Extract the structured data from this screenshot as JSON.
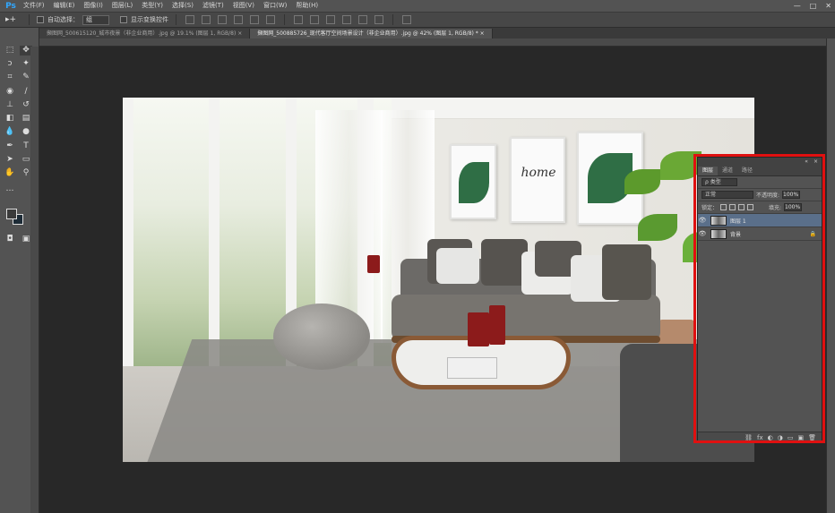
{
  "app": {
    "logo": "Ps"
  },
  "menu": [
    "文件(F)",
    "编辑(E)",
    "图像(I)",
    "图层(L)",
    "类型(Y)",
    "选择(S)",
    "滤镜(T)",
    "视图(V)",
    "窗口(W)",
    "帮助(H)"
  ],
  "window_controls": [
    "—",
    "□",
    "✕"
  ],
  "options_bar": {
    "auto_select_label": "自动选择：",
    "auto_select_value": "组",
    "show_transform_label": "显示变换控件"
  },
  "tabs": [
    {
      "label": "撷图网_500615120_城市夜景（非企业商用）.jpg @ 19.1% (图层 1, RGB/8) ×",
      "active": false
    },
    {
      "label": "撷图网_500885726_现代客厅空间场景设计（非企业商用）.jpg @ 42% (图层 1, RGB/8) * ×",
      "active": true
    }
  ],
  "artwork": {
    "home_text": "home"
  },
  "layers_panel": {
    "header_icons": [
      "«",
      "×"
    ],
    "tabs": [
      "图层",
      "通道",
      "路径"
    ],
    "filter_label": "ρ 类型",
    "blend_mode": "正常",
    "opacity_label": "不透明度:",
    "opacity_value": "100%",
    "lock_label": "锁定：",
    "fill_label": "填充:",
    "fill_value": "100%",
    "layers": [
      {
        "name": "图层 1",
        "selected": true,
        "visible_icon": "👁"
      },
      {
        "name": "背景",
        "selected": false,
        "visible_icon": "👁",
        "locked": true
      }
    ],
    "footer_icons": [
      "⛓",
      "fx",
      "◐",
      "◑",
      "▭",
      "▣",
      "🗑"
    ]
  },
  "colors": {
    "highlight": "#e01010",
    "selected_layer": "#5a6f8a",
    "ps_blue": "#31a8ff"
  }
}
